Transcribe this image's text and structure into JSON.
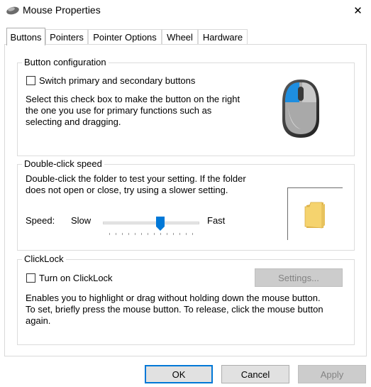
{
  "window": {
    "title": "Mouse Properties",
    "close_glyph": "✕"
  },
  "tabs": [
    {
      "label": "Buttons",
      "active": true
    },
    {
      "label": "Pointers",
      "active": false
    },
    {
      "label": "Pointer Options",
      "active": false
    },
    {
      "label": "Wheel",
      "active": false
    },
    {
      "label": "Hardware",
      "active": false
    }
  ],
  "button_config": {
    "group_label": "Button configuration",
    "switch_checkbox_label": "Switch primary and secondary buttons",
    "switch_checked": false,
    "description_lines": [
      "Select this check box to make the button on the right",
      "the one you use for primary functions such as",
      "selecting and dragging."
    ],
    "mouse_icon": "mouse-icon"
  },
  "double_click": {
    "group_label": "Double-click speed",
    "description_lines": [
      "Double-click the folder to test your setting. If the folder",
      "does not open or close, try using a slower setting."
    ],
    "speed_label": "Speed:",
    "slow_label": "Slow",
    "fast_label": "Fast",
    "slider_level": 0.6,
    "folder_icon": "folder-icon"
  },
  "clicklock": {
    "group_label": "ClickLock",
    "checkbox_label": "Turn on ClickLock",
    "checked": false,
    "settings_button": "Settings...",
    "settings_enabled": false,
    "description_lines": [
      "Enables you to highlight or drag without holding down the mouse button.",
      "To set, briefly press the mouse button. To release, click the mouse button",
      "again."
    ]
  },
  "footer": {
    "ok_label": "OK",
    "cancel_label": "Cancel",
    "apply_label": "Apply",
    "apply_enabled": false
  },
  "colors": {
    "accent": "#0078d7",
    "mouse_blue": "#1e8ee0",
    "folder_yellow": "#f5d36e"
  }
}
